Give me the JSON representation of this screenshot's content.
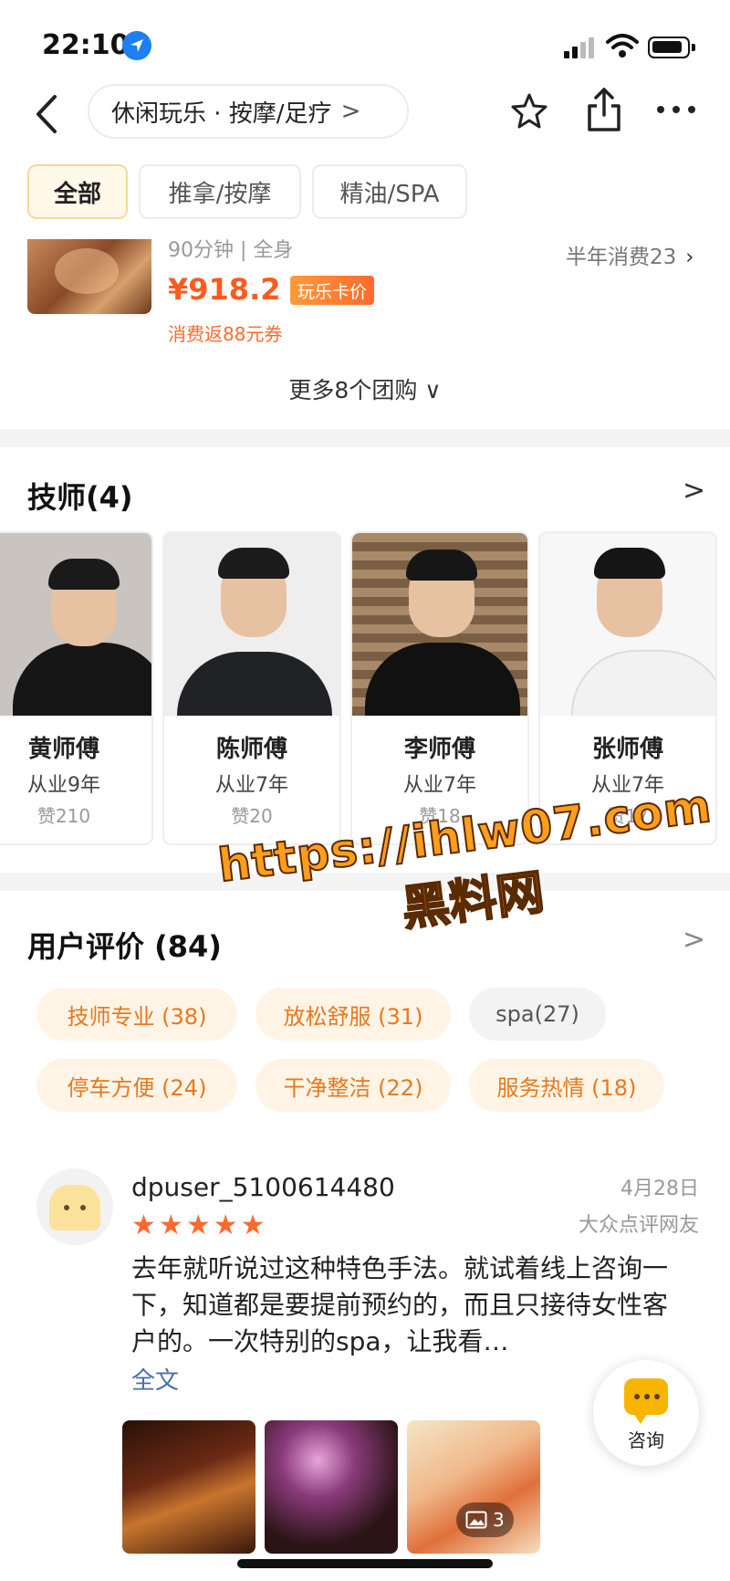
{
  "status_bar": {
    "time": "22:10"
  },
  "nav": {
    "breadcrumb": "休闲玩乐 · 按摩/足疗",
    "breadcrumb_chevron": ">"
  },
  "tabs": [
    {
      "label": "全部",
      "active": true
    },
    {
      "label": "推拿/按摩",
      "active": false
    },
    {
      "label": "精油/SPA",
      "active": false
    }
  ],
  "deal": {
    "subtitle": "90分钟 | 全身",
    "sold": "半年消费23",
    "price": "¥918.2",
    "price_tag": "玩乐卡价",
    "coupon": "消费返88元券",
    "more_deals": "更多8个团购 ∨"
  },
  "technicians": {
    "title": "技师(4)",
    "chevron": ">",
    "items": [
      {
        "name": "黄师傅",
        "years": "从业9年",
        "likes": "赞210"
      },
      {
        "name": "陈师傅",
        "years": "从业7年",
        "likes": "赞20"
      },
      {
        "name": "李师傅",
        "years": "从业7年",
        "likes": "赞18"
      },
      {
        "name": "张师傅",
        "years": "从业7年",
        "likes": "赞17"
      }
    ]
  },
  "reviews": {
    "title": "用户评价 (84)",
    "chevron": ">",
    "tags": [
      {
        "label": "技师专业 (38)",
        "style": "warm"
      },
      {
        "label": "放松舒服 (31)",
        "style": "warm"
      },
      {
        "label": "spa(27)",
        "style": "grey"
      },
      {
        "label": "停车方便 (24)",
        "style": "warm"
      },
      {
        "label": "干净整洁 (22)",
        "style": "warm"
      },
      {
        "label": "服务热情 (18)",
        "style": "warm"
      }
    ],
    "items": [
      {
        "user": "dpuser_5100614480",
        "rating_stars": 5,
        "date": "4月28日",
        "source": "大众点评网友",
        "text": "去年就听说过这种特色手法。就试着线上咨询一下，知道都是要提前预约的，而且只接待女性客户的。一次特别的spa，让我看…",
        "read_more": "全文",
        "photo_count": "3"
      }
    ]
  },
  "consult": {
    "label": "咨询"
  },
  "watermark": {
    "url": "https://ihlw07.com",
    "name": "黑料网"
  },
  "colors": {
    "price": "#ff5a1f",
    "tag_warm_bg": "#fff4e6",
    "tag_warm_text": "#e8781e",
    "star": "#ff6a2c",
    "link": "#4a6ea8",
    "watermark": "#ff9e1b"
  },
  "icons": [
    "location-arrow-icon",
    "signal-icon",
    "wifi-icon",
    "battery-icon",
    "back-icon",
    "star-outline-icon",
    "share-icon",
    "more-icon",
    "chevron-right-icon",
    "star-filled-icon",
    "image-icon",
    "chat-bubble-icon"
  ]
}
